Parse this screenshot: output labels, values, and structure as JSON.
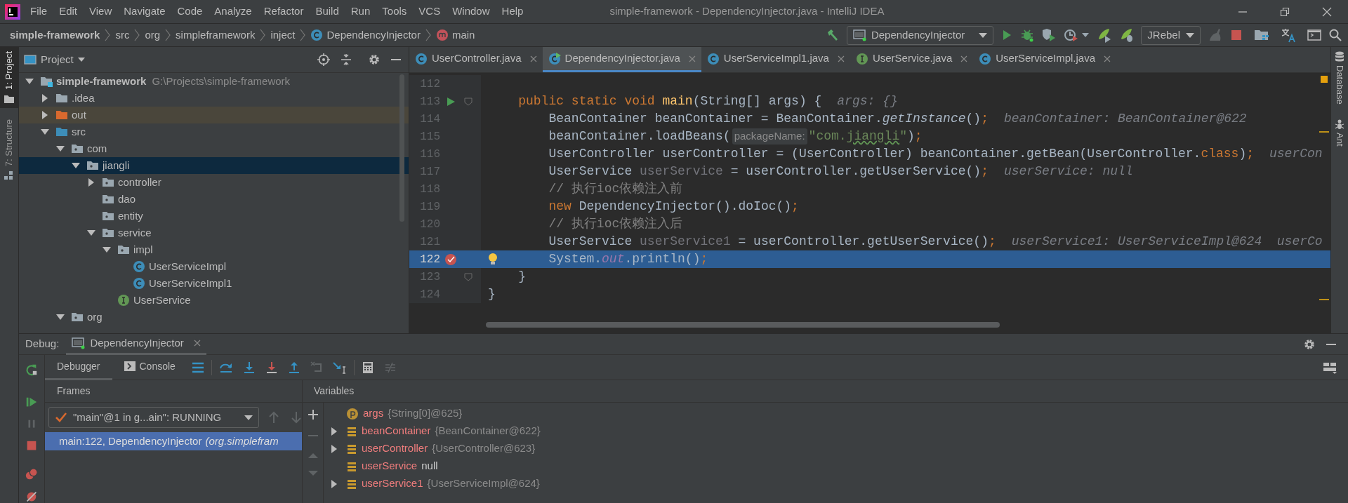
{
  "menu_bar": {
    "items": [
      "File",
      "Edit",
      "View",
      "Navigate",
      "Code",
      "Analyze",
      "Refactor",
      "Build",
      "Run",
      "Tools",
      "VCS",
      "Window",
      "Help"
    ]
  },
  "window": {
    "title": "simple-framework - DependencyInjector.java - IntelliJ IDEA"
  },
  "breadcrumbs": [
    {
      "label": "simple-framework",
      "kind": "project"
    },
    {
      "label": "src",
      "kind": "plain"
    },
    {
      "label": "org",
      "kind": "plain"
    },
    {
      "label": "simpleframework",
      "kind": "plain"
    },
    {
      "label": "inject",
      "kind": "plain"
    },
    {
      "label": "DependencyInjector",
      "kind": "class"
    },
    {
      "label": "main",
      "kind": "method"
    }
  ],
  "run_toolbar": {
    "configuration": "DependencyInjector",
    "jrebel": "JRebel"
  },
  "left_tool_strip": [
    {
      "label": "1: Project",
      "selected": true
    },
    {
      "label": "7: Structure",
      "selected": false
    }
  ],
  "right_tool_strip": [
    {
      "label": "Database",
      "kind": "database"
    },
    {
      "label": "Ant",
      "kind": "ant"
    }
  ],
  "project_panel": {
    "title": "Project",
    "tree": [
      {
        "name": "simple-framework",
        "path": "G:\\Projects\\simple-framework",
        "kind": "module",
        "expanded": true,
        "selected": false,
        "children": [
          {
            "name": ".idea",
            "kind": "folder",
            "expanded": false,
            "selected": false
          },
          {
            "name": "out",
            "kind": "excluded",
            "expanded": false,
            "selected": false
          },
          {
            "name": "src",
            "kind": "source",
            "expanded": true,
            "selected": false,
            "children": [
              {
                "name": "com",
                "kind": "package",
                "expanded": true,
                "selected": false,
                "children": [
                  {
                    "name": "jiangli",
                    "kind": "package",
                    "expanded": true,
                    "selected": true,
                    "children": [
                      {
                        "name": "controller",
                        "kind": "package",
                        "expanded": false,
                        "selected": false
                      },
                      {
                        "name": "dao",
                        "kind": "package",
                        "selected": false
                      },
                      {
                        "name": "entity",
                        "kind": "package",
                        "selected": false
                      },
                      {
                        "name": "service",
                        "kind": "package",
                        "expanded": true,
                        "selected": false,
                        "children": [
                          {
                            "name": "impl",
                            "kind": "package",
                            "expanded": true,
                            "selected": false,
                            "children": [
                              {
                                "name": "UserServiceImpl",
                                "kind": "class",
                                "selected": false
                              },
                              {
                                "name": "UserServiceImpl1",
                                "kind": "class",
                                "selected": false
                              }
                            ]
                          },
                          {
                            "name": "UserService",
                            "kind": "interface",
                            "selected": false
                          }
                        ]
                      }
                    ]
                  }
                ]
              },
              {
                "name": "org",
                "kind": "package",
                "expanded": true,
                "selected": false
              }
            ]
          }
        ]
      }
    ]
  },
  "editor_tabs": [
    {
      "label": "UserController.java",
      "kind": "class",
      "selected": false
    },
    {
      "label": "DependencyInjector.java",
      "kind": "runnable-class",
      "selected": true
    },
    {
      "label": "UserServiceImpl1.java",
      "kind": "class",
      "selected": false
    },
    {
      "label": "UserService.java",
      "kind": "interface",
      "selected": false
    },
    {
      "label": "UserServiceImpl.java",
      "kind": "class",
      "selected": false
    }
  ],
  "editor": {
    "lines": [
      {
        "number": "112",
        "kind": "plain",
        "fold": false,
        "current": false
      },
      {
        "number": "113",
        "kind": "run",
        "fold": true,
        "current": false,
        "tokens": [
          {
            "text": "    public static void ",
            "kind": "kw"
          },
          {
            "text": "main",
            "kind": "method-decl"
          },
          {
            "text": "(String[] args) {",
            "kind": "text"
          },
          {
            "text": "args: {}",
            "kind": "inline"
          }
        ]
      },
      {
        "number": "114",
        "kind": "plain",
        "fold": false,
        "current": false,
        "tokens": [
          {
            "text": "        BeanContainer beanContainer = BeanContainer.",
            "kind": "text"
          },
          {
            "text": "getInstance",
            "kind": "static"
          },
          {
            "text": "()",
            "kind": "text"
          },
          {
            "text": ";",
            "kind": "kw"
          },
          {
            "text": "beanContainer: BeanContainer@622",
            "kind": "inline"
          }
        ]
      },
      {
        "number": "115",
        "kind": "plain",
        "fold": false,
        "current": false,
        "tokens": [
          {
            "text": "        beanContainer.loadBeans(",
            "kind": "text"
          },
          {
            "text": "packageName:",
            "kind": "hint"
          },
          {
            "text": "\"com.",
            "kind": "string"
          },
          {
            "text": "jiangli",
            "kind": "string-typo"
          },
          {
            "text": "\"",
            "kind": "string"
          },
          {
            "text": ")",
            "kind": "text"
          },
          {
            "text": ";",
            "kind": "kw"
          }
        ]
      },
      {
        "number": "116",
        "kind": "plain",
        "fold": false,
        "current": false,
        "tokens": [
          {
            "text": "        UserController userController = (UserController) beanContainer.getBean(UserController.",
            "kind": "text"
          },
          {
            "text": "class",
            "kind": "kw"
          },
          {
            "text": ")",
            "kind": "text"
          },
          {
            "text": ";",
            "kind": "kw"
          },
          {
            "text": "userCon",
            "kind": "inline"
          }
        ]
      },
      {
        "number": "117",
        "kind": "plain",
        "fold": false,
        "current": false,
        "tokens": [
          {
            "text": "        UserService ",
            "kind": "text"
          },
          {
            "text": "userService",
            "kind": "unused"
          },
          {
            "text": " = userController.getUserService()",
            "kind": "text"
          },
          {
            "text": ";",
            "kind": "kw"
          },
          {
            "text": "userService: null",
            "kind": "inline"
          }
        ]
      },
      {
        "number": "118",
        "kind": "plain",
        "fold": false,
        "current": false,
        "tokens": [
          {
            "text": "        // 执行ioc依赖注入前",
            "kind": "comment"
          }
        ]
      },
      {
        "number": "119",
        "kind": "plain",
        "fold": false,
        "current": false,
        "tokens": [
          {
            "text": "        new ",
            "kind": "kw"
          },
          {
            "text": "DependencyInjector().doIoc()",
            "kind": "text"
          },
          {
            "text": ";",
            "kind": "kw"
          }
        ]
      },
      {
        "number": "120",
        "kind": "plain",
        "fold": false,
        "current": false,
        "tokens": [
          {
            "text": "        // 执行ioc依赖注入后",
            "kind": "comment"
          }
        ]
      },
      {
        "number": "121",
        "kind": "plain",
        "fold": false,
        "current": false,
        "tokens": [
          {
            "text": "        UserService ",
            "kind": "text"
          },
          {
            "text": "userService1",
            "kind": "unused"
          },
          {
            "text": " = userController.getUserService()",
            "kind": "text"
          },
          {
            "text": ";",
            "kind": "kw"
          },
          {
            "text": "userService1: UserServiceImpl@624  userCo",
            "kind": "inline"
          }
        ]
      },
      {
        "number": "122",
        "kind": "breakpoint",
        "fold": false,
        "current": true,
        "tokens": [
          {
            "text": "        System.",
            "kind": "text"
          },
          {
            "text": "out",
            "kind": "field"
          },
          {
            "text": ".println()",
            "kind": "text"
          },
          {
            "text": ";",
            "kind": "kw"
          }
        ]
      },
      {
        "number": "123",
        "kind": "plain",
        "fold": true,
        "current": false,
        "tokens": [
          {
            "text": "    }",
            "kind": "text"
          }
        ]
      },
      {
        "number": "124",
        "kind": "plain",
        "fold": false,
        "current": false,
        "tokens": [
          {
            "text": "}",
            "kind": "text"
          }
        ]
      }
    ]
  },
  "debug": {
    "label": "Debug:",
    "session_tab": "DependencyInjector",
    "subtabs": [
      {
        "label": "Debugger",
        "kind": "debugger",
        "selected": true
      },
      {
        "label": "Console",
        "kind": "console",
        "selected": false
      }
    ],
    "frames_title": "Frames",
    "thread": "\"main\"@1 in g...ain\": RUNNING",
    "frames": [
      {
        "location": "main:122, DependencyInjector",
        "package": "(org.simplefram",
        "selected": true
      }
    ],
    "variables_title": "Variables",
    "variables": [
      {
        "name": "args",
        "value": "{String[0]@625}",
        "kind": "param"
      },
      {
        "name": "beanContainer",
        "value": "{BeanContainer@622}",
        "kind": "local",
        "expanded": false
      },
      {
        "name": "userController",
        "value": "{UserController@623}",
        "kind": "local",
        "expanded": false
      },
      {
        "name": "userService",
        "value": "null",
        "kind": "local"
      },
      {
        "name": "userService1",
        "value": "{UserServiceImpl@624}",
        "kind": "local",
        "expanded": false
      }
    ]
  }
}
